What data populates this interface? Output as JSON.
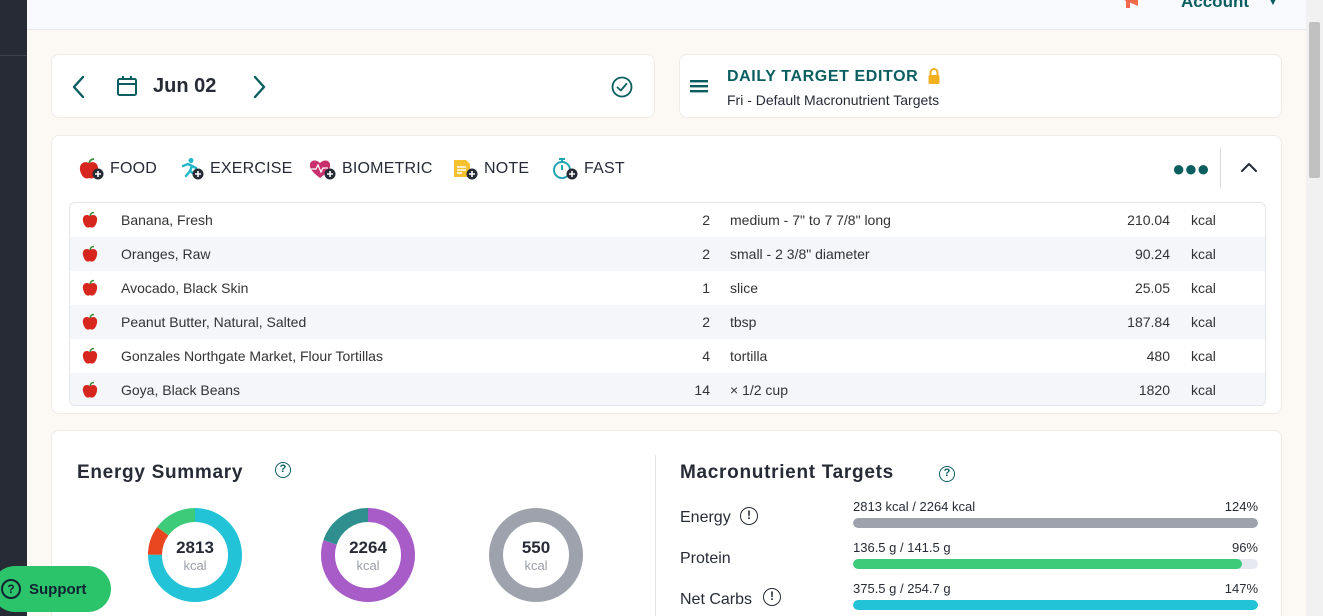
{
  "topbar": {
    "account_label": "Account"
  },
  "date_nav": {
    "date": "Jun 02"
  },
  "target_editor": {
    "title": "DAILY TARGET EDITOR",
    "subtitle": "Fri - Default Macronutrient Targets"
  },
  "add_buttons": {
    "food": "FOOD",
    "exercise": "EXERCISE",
    "biometric": "BIOMETRIC",
    "note": "NOTE",
    "fast": "FAST"
  },
  "entries": [
    {
      "name": "Banana, Fresh",
      "qty": "2",
      "unit": "medium - 7\" to 7 7/8\" long",
      "calories": "210.04",
      "cal_unit": "kcal"
    },
    {
      "name": "Oranges, Raw",
      "qty": "2",
      "unit": "small - 2 3/8\" diameter",
      "calories": "90.24",
      "cal_unit": "kcal"
    },
    {
      "name": "Avocado, Black Skin",
      "qty": "1",
      "unit": "slice",
      "calories": "25.05",
      "cal_unit": "kcal"
    },
    {
      "name": "Peanut Butter, Natural, Salted",
      "qty": "2",
      "unit": "tbsp",
      "calories": "187.84",
      "cal_unit": "kcal"
    },
    {
      "name": "Gonzales Northgate Market, Flour Tortillas",
      "qty": "4",
      "unit": "tortilla",
      "calories": "480",
      "cal_unit": "kcal"
    },
    {
      "name": "Goya, Black Beans",
      "qty": "14",
      "unit": "× 1/2 cup",
      "calories": "1820",
      "cal_unit": "kcal"
    }
  ],
  "energy_summary": {
    "title": "Energy Summary",
    "help_glyph": "?",
    "consumed": {
      "value": "2813",
      "unit": "kcal",
      "segments": [
        {
          "color": "#22c3d6",
          "fraction": 0.75
        },
        {
          "color": "#e8461e",
          "fraction": 0.1
        },
        {
          "color": "#3dcb7a",
          "fraction": 0.15
        }
      ]
    },
    "burned": {
      "value": "2264",
      "unit": "kcal",
      "segments": [
        {
          "color": "#a75cc8",
          "fraction": 0.8
        },
        {
          "color": "#2f8f8f",
          "fraction": 0.2
        }
      ]
    },
    "remaining": {
      "value": "550",
      "unit": "kcal",
      "segments": [
        {
          "color": "#9ea2ad",
          "fraction": 1.0
        }
      ]
    }
  },
  "macro_targets": {
    "title": "Macronutrient Targets",
    "help_glyph": "?",
    "info_glyph": "!",
    "rows": [
      {
        "label": "Energy",
        "values": "2813 kcal / 2264 kcal",
        "pct": "124%",
        "fill": 1.0,
        "color": "#9ea2ad"
      },
      {
        "label": "Protein",
        "values": "136.5 g / 141.5 g",
        "pct": "96%",
        "fill": 0.96,
        "color": "#3dcb7a"
      },
      {
        "label": "Net Carbs",
        "values": "375.5 g / 254.7 g",
        "pct": "147%",
        "fill": 1.0,
        "color": "#22c3d6"
      }
    ]
  },
  "support": {
    "label": "Support",
    "glyph": "?"
  }
}
